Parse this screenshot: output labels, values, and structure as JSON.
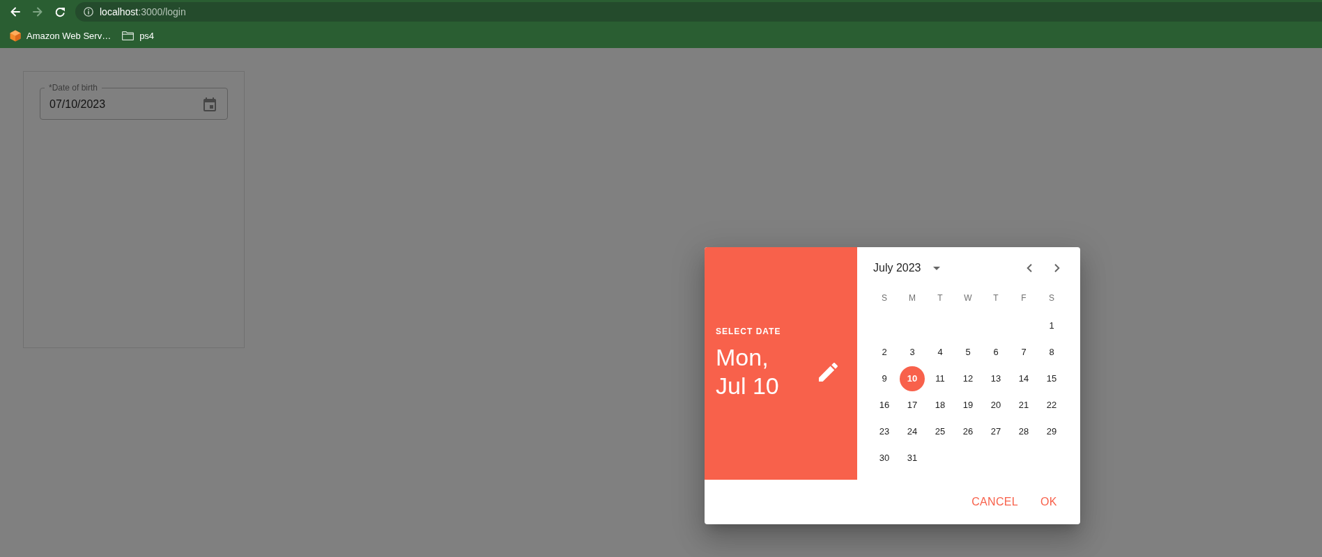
{
  "browser": {
    "nav_buttons": [
      {
        "kind": "back",
        "disabled": false
      },
      {
        "kind": "forward",
        "disabled": true
      },
      {
        "kind": "reload",
        "disabled": false
      }
    ],
    "address": {
      "host": "localhost",
      "path": ":3000/login"
    },
    "bookmarks": [
      {
        "kind": "cube",
        "label": "Amazon Web Serv…"
      },
      {
        "kind": "folder",
        "label": "ps4"
      }
    ]
  },
  "form": {
    "date_field": {
      "label": "*Date of birth",
      "value": "07/10/2023"
    }
  },
  "date_picker": {
    "caption": "SELECT DATE",
    "selected_date": "Mon, Jul 10",
    "month": "July 2023",
    "weekdays": [
      "S",
      "M",
      "T",
      "W",
      "T",
      "F",
      "S"
    ],
    "weeks": [
      [
        {
          "day": "1",
          "selected": false
        }
      ],
      [
        {
          "day": "2",
          "selected": false
        },
        {
          "day": "3",
          "selected": false
        },
        {
          "day": "4",
          "selected": false
        },
        {
          "day": "5",
          "selected": false
        },
        {
          "day": "6",
          "selected": false
        },
        {
          "day": "7",
          "selected": false
        },
        {
          "day": "8",
          "selected": false
        }
      ],
      [
        {
          "day": "9",
          "selected": false
        },
        {
          "day": "10",
          "selected": true
        },
        {
          "day": "11",
          "selected": false
        },
        {
          "day": "12",
          "selected": false
        },
        {
          "day": "13",
          "selected": false
        },
        {
          "day": "14",
          "selected": false
        },
        {
          "day": "15",
          "selected": false
        }
      ],
      [
        {
          "day": "16",
          "selected": false
        },
        {
          "day": "17",
          "selected": false
        },
        {
          "day": "18",
          "selected": false
        },
        {
          "day": "19",
          "selected": false
        },
        {
          "day": "20",
          "selected": false
        },
        {
          "day": "21",
          "selected": false
        },
        {
          "day": "22",
          "selected": false
        }
      ],
      [
        {
          "day": "23",
          "selected": false
        },
        {
          "day": "24",
          "selected": false
        },
        {
          "day": "25",
          "selected": false
        },
        {
          "day": "26",
          "selected": false
        },
        {
          "day": "27",
          "selected": false
        },
        {
          "day": "28",
          "selected": false
        },
        {
          "day": "29",
          "selected": false
        }
      ],
      [
        {
          "day": "30",
          "selected": false
        },
        {
          "day": "31",
          "selected": false
        }
      ]
    ],
    "actions": [
      "CANCEL",
      "OK"
    ]
  }
}
